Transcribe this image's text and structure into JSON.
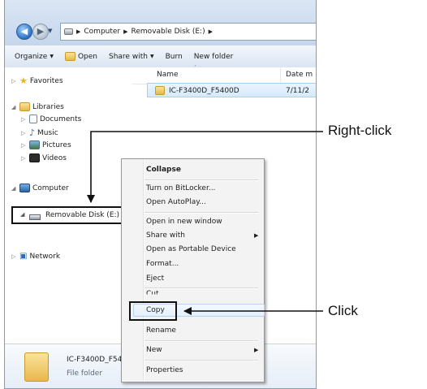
{
  "address": {
    "crumbs": [
      "Computer",
      "Removable Disk (E:)"
    ]
  },
  "toolbar": {
    "organize": "Organize",
    "open": "Open",
    "share_with": "Share with",
    "burn": "Burn",
    "new_folder": "New folder"
  },
  "nav": {
    "favorites": "Favorites",
    "libraries": "Libraries",
    "documents": "Documents",
    "music": "Music",
    "pictures": "Pictures",
    "videos": "Videos",
    "computer": "Computer",
    "removable_disk": "Removable Disk (E:)",
    "network": "Network"
  },
  "list": {
    "col_name": "Name",
    "col_date": "Date m",
    "file_name": "IC-F3400D_F5400D",
    "file_date": "7/11/2"
  },
  "details": {
    "name": "IC-F3400D_F540",
    "type": "File folder"
  },
  "context_menu": {
    "items": [
      "Collapse",
      "Turn on BitLocker...",
      "Open AutoPlay...",
      "Open in new window",
      "Share with",
      "Open as Portable Device",
      "Format...",
      "Eject",
      "Cut",
      "Copy",
      "Rename",
      "New",
      "Properties"
    ]
  },
  "annotations": {
    "right_click": "Right-click",
    "click": "Click"
  }
}
